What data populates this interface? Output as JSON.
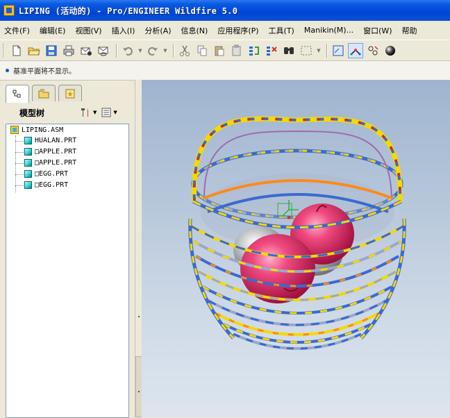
{
  "window": {
    "title": "LIPING (活动的) - Pro/ENGINEER Wildfire 5.0"
  },
  "menu": [
    "文件(F)",
    "编辑(E)",
    "视图(V)",
    "插入(I)",
    "分析(A)",
    "信息(N)",
    "应用程序(P)",
    "工具(T)",
    "Manikin(M)...",
    "窗口(W)",
    "帮助"
  ],
  "message": "基准平面将不显示。",
  "model_tree": {
    "header": "模型树",
    "root": "LIPING.ASM",
    "items": [
      "HUALAN.PRT",
      "□APPLE.PRT",
      "□APPLE.PRT",
      "□EGG.PRT",
      "□EGG.PRT"
    ]
  },
  "colors": {
    "title_bar": "#0a5ae0",
    "viewport_top": "#9fb4cf",
    "viewport_bottom": "#dde5ee",
    "apple": "#e0306a",
    "egg": "#c0c4c8"
  },
  "toolbar_icons": [
    "new-icon",
    "open-icon",
    "save-icon",
    "print-icon",
    "email-icon",
    "email-link-icon",
    "undo-icon",
    "redo-icon",
    "cut-icon",
    "copy-icon",
    "paste-icon",
    "paste-special-icon",
    "regenerate-icon",
    "regen-manager-icon",
    "find-icon",
    "select-box-icon",
    "datum-display-icon",
    "spin-center-icon",
    "view-manager-icon",
    "shading-icon"
  ]
}
